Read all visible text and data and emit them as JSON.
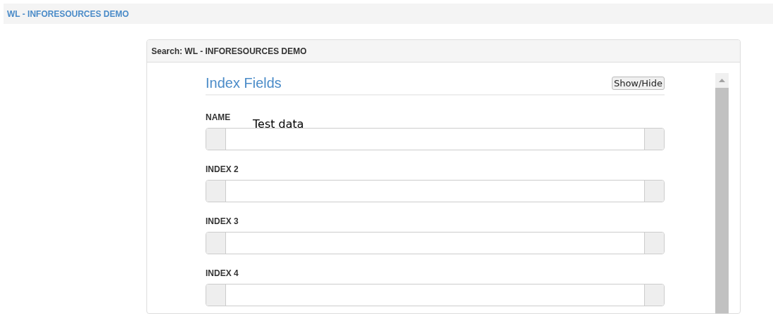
{
  "breadcrumb": "WL - INFORESOURCES DEMO",
  "panel": {
    "title": "Search: WL - INFORESOURCES DEMO",
    "section": {
      "title": "Index Fields",
      "toggle": "Show/Hide"
    },
    "fields": [
      {
        "label": "NAME"
      },
      {
        "label": "INDEX 2"
      },
      {
        "label": "INDEX 3"
      },
      {
        "label": "INDEX 4"
      }
    ]
  },
  "annotation": "Test data"
}
